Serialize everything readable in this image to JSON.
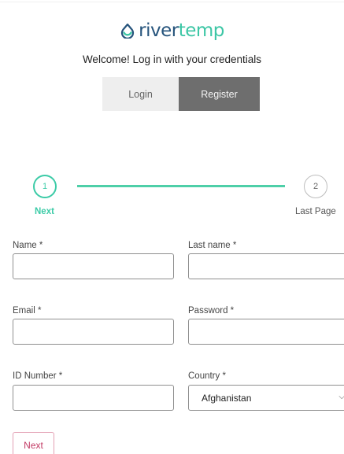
{
  "brand": {
    "name_part1": "river",
    "name_part2": "temp",
    "icon": "droplet-icon",
    "colors": {
      "river": "#26547c",
      "temp": "#3cc6a5"
    }
  },
  "header": {
    "welcome": "Welcome! Log in with your credentials"
  },
  "auth_tabs": {
    "login": "Login",
    "register": "Register",
    "active": "register"
  },
  "stepper": {
    "steps": [
      {
        "number": "1",
        "label": "Next",
        "active": true
      },
      {
        "number": "2",
        "label": "Last Page",
        "active": false
      }
    ],
    "accent": "#3ccba7"
  },
  "form": {
    "name_label": "Name *",
    "name_value": "",
    "last_name_label": "Last name *",
    "last_name_value": "",
    "email_label": "Email *",
    "email_value": "",
    "password_label": "Password *",
    "password_value": "",
    "id_number_label": "ID Number *",
    "id_number_value": "",
    "country_label": "Country *",
    "country_value": "Afghanistan",
    "next_button": "Next"
  }
}
